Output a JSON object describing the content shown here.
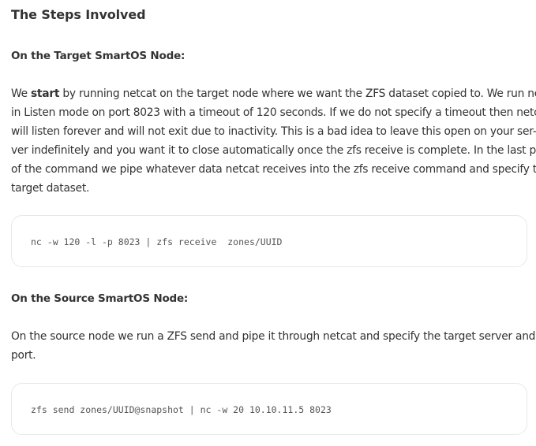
{
  "section": {
    "title": "The Steps Involved"
  },
  "target": {
    "heading": "On the Target SmartOS Node:",
    "para": {
      "l1_pre": "We ",
      "l1_bold": "start",
      "l1_post": " by running netcat on the target node where we want the ZFS dataset copied to. We run netcat",
      "l2": "in Listen mode on port 8023 with a timeout of 120 seconds. If we do not specify a timeout then netcat",
      "l3": "will listen forever and will not exit due to inactivity. This is a bad idea to leave this open on your ser-",
      "l4": "ver indefinitely and you want it to close automatically once the zfs receive is complete. In the last part",
      "l5": "of the command we pipe whatever data netcat receives into the zfs receive command and specify the",
      "l6": "target dataset."
    },
    "code": "nc -w 120 -l -p 8023 | zfs receive  zones/UUID"
  },
  "source": {
    "heading": "On the Source SmartOS Node:",
    "para": {
      "l1": "On the source node we run a ZFS send and pipe it through netcat and  specify the target server and",
      "l2": "port."
    },
    "code": "zfs send zones/UUID@snapshot | nc -w 20 10.10.11.5 8023"
  }
}
